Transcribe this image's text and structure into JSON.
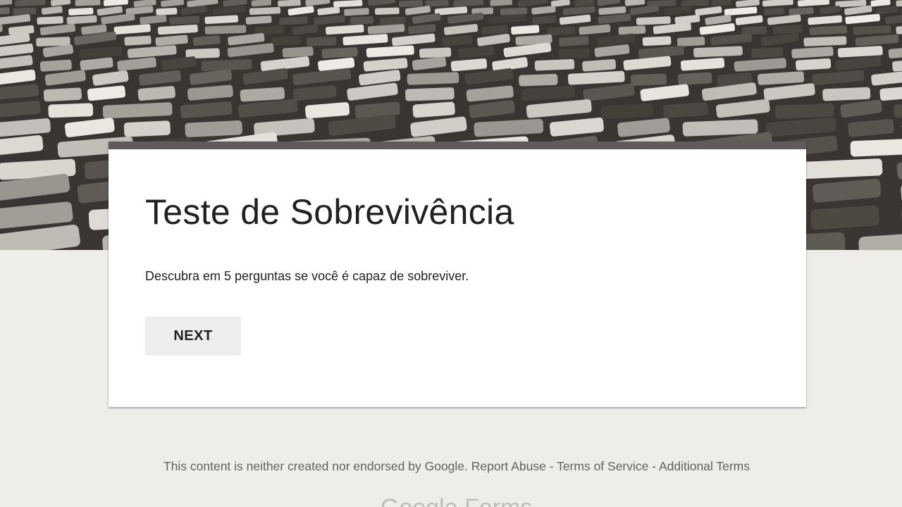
{
  "header": {
    "image_name": "cobblestone-street-photo"
  },
  "form": {
    "title": "Teste de Sobrevivência",
    "description": "Descubra em 5 perguntas se você é capaz de sobreviver.",
    "next_label": "NEXT",
    "theme_color": "#5f5a5b"
  },
  "footer": {
    "disclaimer": "This content is neither created nor endorsed by Google.",
    "report_abuse": "Report Abuse",
    "separator": " - ",
    "terms_of_service": "Terms of Service",
    "additional_terms": "Additional Terms",
    "brand": "Google Forms"
  }
}
